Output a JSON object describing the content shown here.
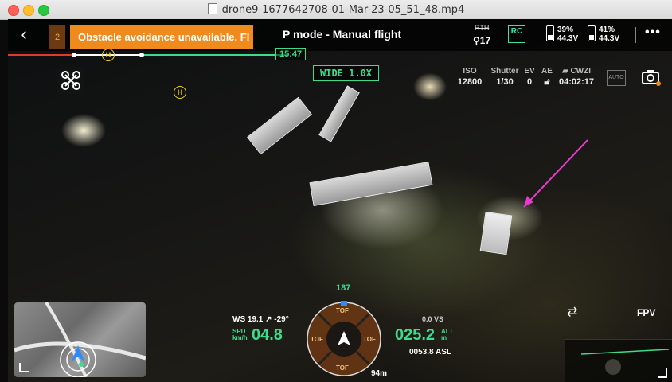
{
  "window": {
    "title": "drone9-1677642708-01-Mar-23-05_51_48.mp4"
  },
  "topbar": {
    "warning_count": "2",
    "warning_text": "Obstacle avoidance unavailable. Fl",
    "flight_mode": "P mode - Manual flight",
    "rth_label": "RTH",
    "satellites": "17",
    "rc_label": "RC",
    "battery1_pct": "39%",
    "battery1_volt": "44.3V",
    "battery2_pct": "41%",
    "battery2_volt": "44.3V"
  },
  "flight": {
    "timestamp": "15:47",
    "camera_mode": "WIDE 1.0X",
    "home_marker": "H"
  },
  "camera": {
    "iso_label": "ISO",
    "iso": "12800",
    "shutter_label": "Shutter",
    "shutter": "1/30",
    "ev_label": "EV",
    "ev": "0",
    "ae_label": "AE",
    "storage_label": "CWZI",
    "remaining": "04:02:17",
    "auto_label": "AUTO"
  },
  "telemetry": {
    "wind": "WS 19.1 ↗ -29°",
    "speed_label_1": "SPD",
    "speed_label_2": "km/h",
    "speed": "04.8",
    "altitude": "025.2",
    "alt_label_1": "ALT",
    "alt_label_2": "m",
    "vertical_speed": "0.0 VS",
    "asl": "0053.8 ASL",
    "heading": "187",
    "distance": "94m",
    "tof_label": "TOF"
  },
  "views": {
    "fpv_label": "FPV"
  },
  "colors": {
    "accent": "#3cdc8c",
    "warning": "#f08a1c",
    "annotation": "#e83ad0"
  }
}
